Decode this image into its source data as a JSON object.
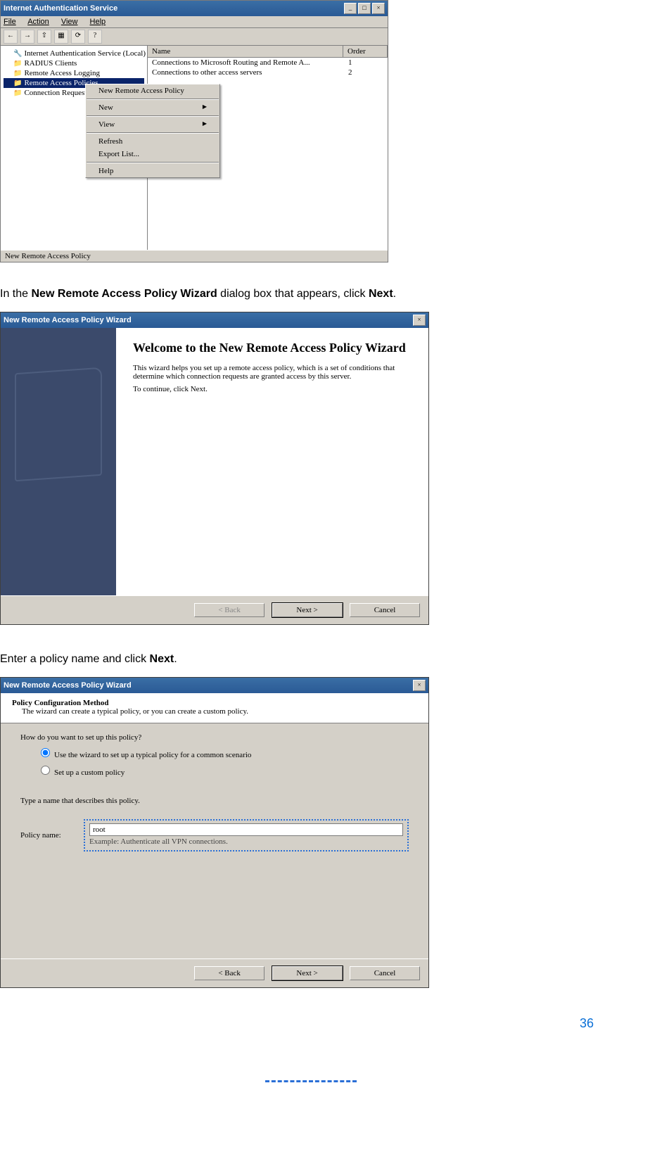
{
  "mmc": {
    "title": "Internet Authentication Service",
    "menus": [
      "File",
      "Action",
      "View",
      "Help"
    ],
    "tree_root": "Internet Authentication Service (Local)",
    "tree_items": [
      "RADIUS Clients",
      "Remote Access Logging",
      "Remote Access Policies",
      "Connection Request Pr"
    ],
    "tree_selected_index": 2,
    "list_header_name": "Name",
    "list_header_order": "Order",
    "list_rows": [
      {
        "name": "Connections to Microsoft Routing and Remote A...",
        "order": "1"
      },
      {
        "name": "Connections to other access servers",
        "order": "2"
      }
    ],
    "context_menu": [
      "New Remote Access Policy",
      "New",
      "View",
      "Refresh",
      "Export List...",
      "Help"
    ],
    "statusbar": "New Remote Access Policy"
  },
  "instr1_pre": "In the ",
  "instr1_b1": "New Remote Access Policy Wizard",
  "instr1_mid": " dialog box that appears, click ",
  "instr1_b2": "Next",
  "instr1_post": ".",
  "wizard1": {
    "title": "New Remote Access Policy Wizard",
    "heading": "Welcome to the New Remote Access Policy Wizard",
    "p1": "This wizard helps you set up a remote access policy, which is a set of conditions that determine which connection requests are granted access by this server.",
    "p2": "To continue, click Next.",
    "back": "< Back",
    "next": "Next >",
    "cancel": "Cancel"
  },
  "instr2_pre": "Enter a policy name and click ",
  "instr2_b1": "Next",
  "instr2_post": ".",
  "wizard2": {
    "title": "New Remote Access Policy Wizard",
    "head_bold": "Policy Configuration Method",
    "head_sub": "The wizard can create a typical policy, or you can create a custom policy.",
    "q": "How do you want to set up this policy?",
    "opt1": "Use the wizard to set up a typical policy for a common scenario",
    "opt2": "Set up a custom policy",
    "type_label": "Type a name that describes this policy.",
    "policy_label": "Policy name:",
    "policy_value": "root",
    "example": "Example: Authenticate all VPN connections.",
    "back": "< Back",
    "next": "Next >",
    "cancel": "Cancel"
  },
  "page_number": "36"
}
